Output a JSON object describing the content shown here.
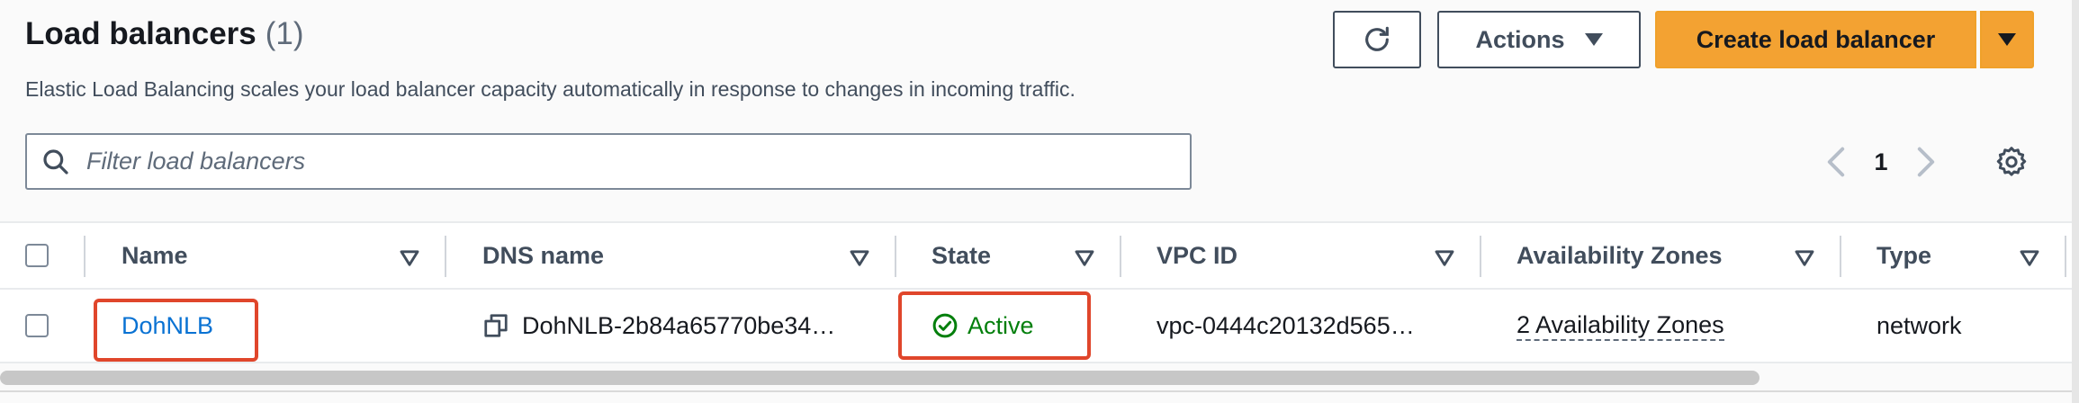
{
  "header": {
    "title": "Load balancers",
    "count": "(1)",
    "subtitle": "Elastic Load Balancing scales your load balancer capacity automatically in response to changes in incoming traffic.",
    "actions_label": "Actions",
    "create_label": "Create load balancer"
  },
  "search": {
    "placeholder": "Filter load balancers"
  },
  "pagination": {
    "current_page": "1"
  },
  "table": {
    "columns": [
      "Name",
      "DNS name",
      "State",
      "VPC ID",
      "Availability Zones",
      "Type"
    ],
    "rows": [
      {
        "name": "DohNLB",
        "dns_name": "DohNLB-2b84a65770be34…",
        "state": "Active",
        "vpc_id": "vpc-0444c20132d565…",
        "availability_zones": "2 Availability Zones",
        "type": "network"
      }
    ]
  },
  "colors": {
    "primary_button": "#f3a232",
    "link": "#0972d3",
    "status_active": "#037f0c",
    "highlight": "#e0462b"
  },
  "icons": [
    "refresh-icon",
    "caret-down-icon",
    "search-icon",
    "chevron-left-icon",
    "chevron-right-icon",
    "gear-icon",
    "sort-icon",
    "copy-icon",
    "status-success-icon"
  ]
}
